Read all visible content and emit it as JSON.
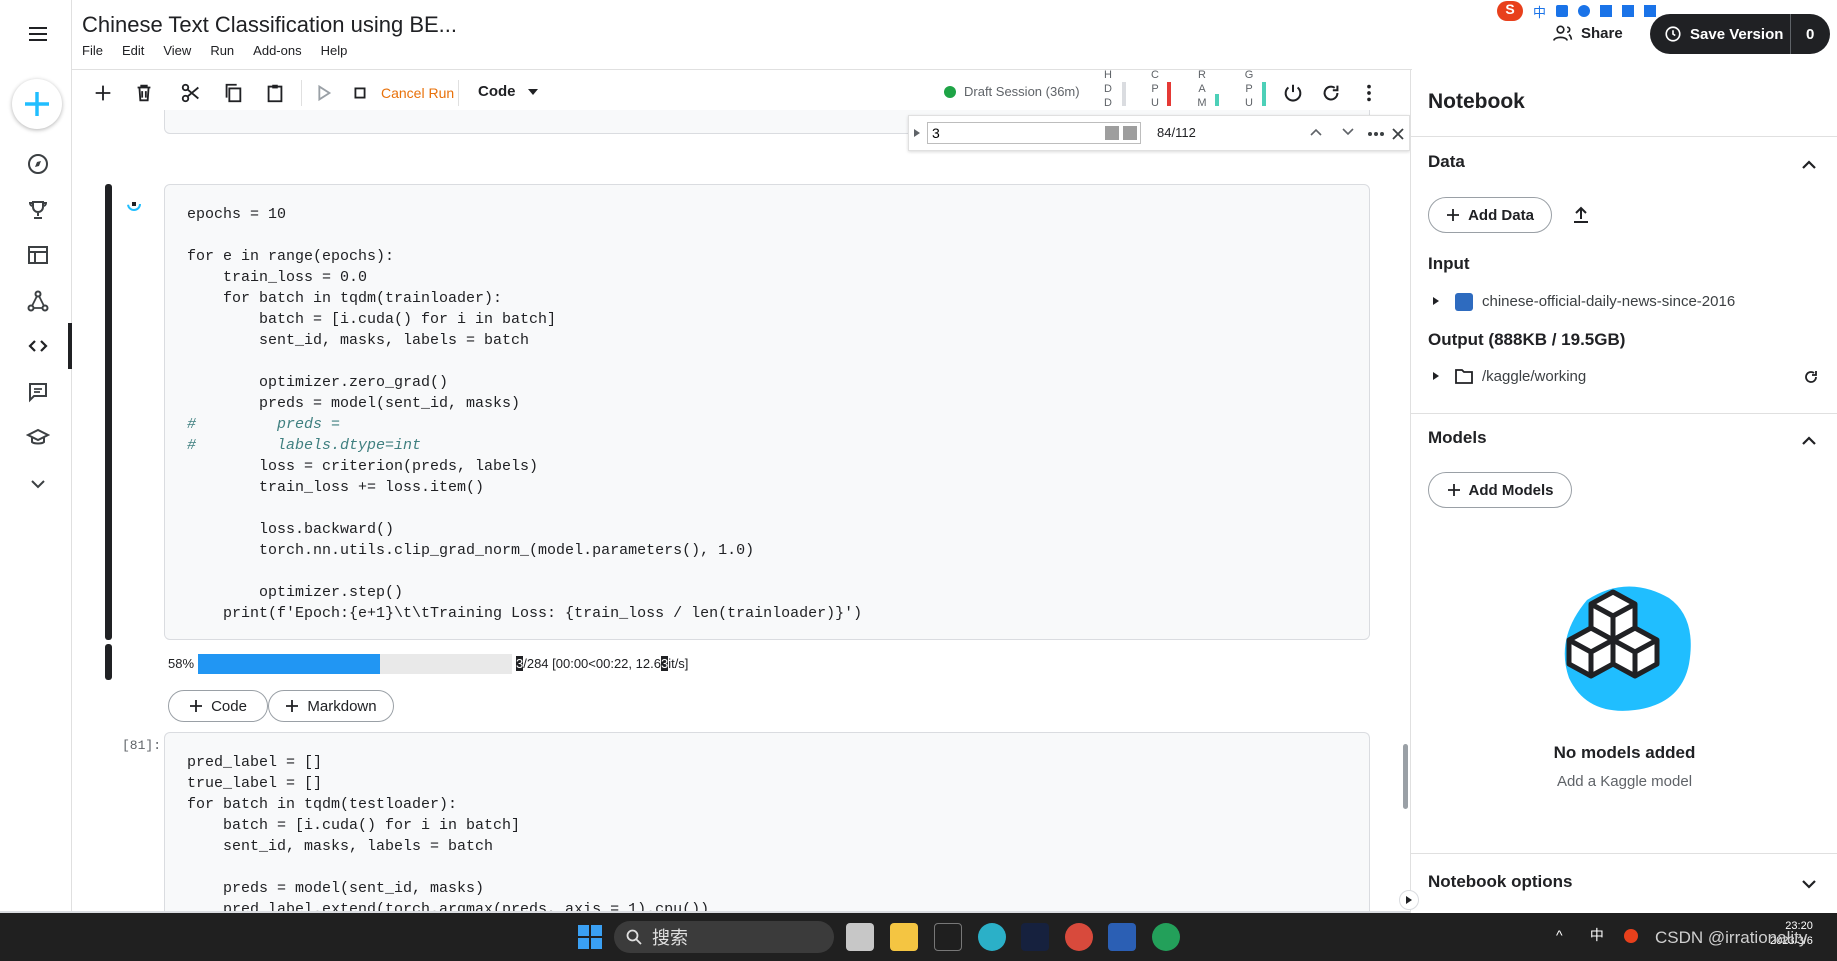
{
  "window": {
    "title": "Chinese Text Classification using BE..."
  },
  "menu": [
    "File",
    "Edit",
    "View",
    "Run",
    "Add-ons",
    "Help"
  ],
  "toolbar": {
    "cancel_run": "Cancel Run",
    "cell_type": "Code",
    "session": "Draft Session (36m)",
    "meters": {
      "hdd": "H\nD\nD",
      "cpu": "C\nP\nU",
      "ram": "R\nA\nM",
      "gpu": "G\nP\nU"
    },
    "icons": [
      "add-cell-icon",
      "delete-icon",
      "cut-icon",
      "copy-icon",
      "paste-icon",
      "run-icon",
      "stop-icon",
      "power-icon",
      "restart-icon",
      "more-vert-icon"
    ]
  },
  "find": {
    "query": "3",
    "count": "84/112"
  },
  "header_right": {
    "share": "Share",
    "save_version": "Save Version",
    "version_count": "0"
  },
  "cells": {
    "cell1_lines": [
      "epochs = 10",
      "",
      "for e in range(epochs):",
      "    train_loss = 0.0",
      "    for batch in tqdm(trainloader):",
      "        batch = [i.cuda() for i in batch]",
      "        sent_id, masks, labels = batch",
      "",
      "        optimizer.zero_grad()",
      "        preds = model(sent_id, masks)",
      "#         preds =",
      "#         labels.dtype=int",
      "        loss = criterion(preds, labels)",
      "        train_loss += loss.item()",
      "",
      "        loss.backward()",
      "        torch.nn.utils.clip_grad_norm_(model.parameters(), 1.0)",
      "",
      "        optimizer.step()",
      "    print(f'Epoch:{e+1}\\t\\tTraining Loss: {train_loss / len(trainloader)}')"
    ],
    "progress": {
      "percent_label": "58%",
      "fraction": 0.58,
      "current": "3",
      "stats": "/284 [00:00<00:22, 12.6",
      "stats_tail": "it/s]",
      "stats_hl": "3"
    },
    "add_code": "Code",
    "add_markdown": "Markdown",
    "exec_count": "[81]:",
    "cell2_lines": [
      "pred_label = []",
      "true_label = []",
      "for batch in tqdm(testloader):",
      "    batch = [i.cuda() for i in batch]",
      "    sent_id, masks, labels = batch",
      "",
      "    preds = model(sent_id, masks)",
      "    pred_label.extend(torch.argmax(preds, axis = 1).cpu())"
    ]
  },
  "panel": {
    "title": "Notebook",
    "data_header": "Data",
    "add_data": "Add Data",
    "input_header": "Input",
    "input_item": "chinese-official-daily-news-since-2016",
    "output_header": "Output (888KB / 19.5GB)",
    "output_item": "/kaggle/working",
    "models_header": "Models",
    "add_models": "Add Models",
    "no_models": "No models added",
    "no_models_sub": "Add a Kaggle model",
    "options_header": "Notebook options"
  },
  "taskbar": {
    "search_placeholder": "搜索",
    "tray_lang": "中",
    "clock_time": "23:20",
    "clock_date": "2023/3/6",
    "watermark": "CSDN @irrationality"
  },
  "colors": {
    "accent": "#20beff",
    "progress": "#2196f3",
    "cancel": "#e8710a",
    "session_dot": "#1ea446",
    "dark": "#202124"
  }
}
